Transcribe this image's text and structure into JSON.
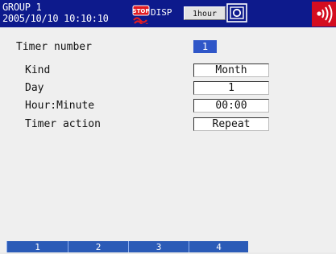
{
  "header": {
    "group": "GROUP 1",
    "datetime": "2005/10/10 10:10:10",
    "disp_label": "DISP",
    "trend_interval": "1hour",
    "colors": {
      "bar": "#0d1a8c",
      "alarm": "#d40d20"
    }
  },
  "icons": {
    "stop": "stop-icon",
    "snapshot": "snapshot-icon",
    "alarm": "alarm-sound-icon"
  },
  "form": {
    "timer_number": {
      "label": "Timer number",
      "value": "1"
    },
    "kind": {
      "label": "Kind",
      "value": "Month"
    },
    "day": {
      "label": "Day",
      "value": "1"
    },
    "hour_minute": {
      "label": "Hour:Minute",
      "value": "00:00"
    },
    "timer_action": {
      "label": "Timer action",
      "value": "Repeat"
    }
  },
  "softkeys": [
    "1",
    "2",
    "3",
    "4"
  ]
}
